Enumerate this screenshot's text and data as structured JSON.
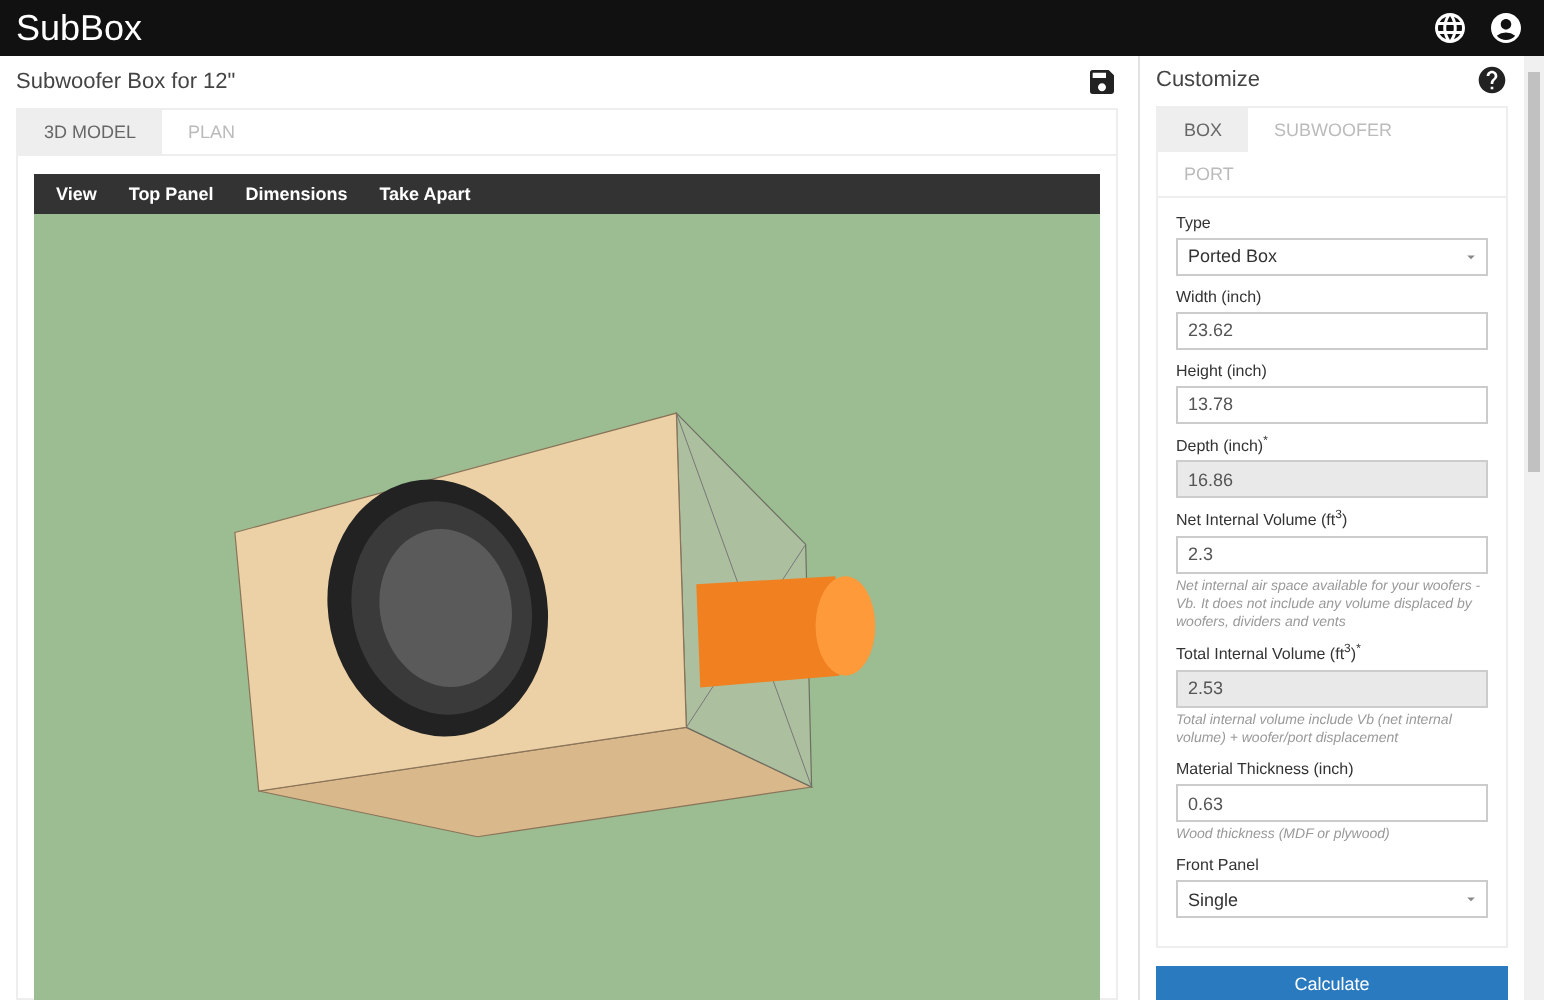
{
  "app": {
    "title": "SubBox"
  },
  "project": {
    "title": "Subwoofer Box for 12\""
  },
  "view_tabs": [
    {
      "label": "3D MODEL",
      "selected": true
    },
    {
      "label": "PLAN",
      "selected": false
    }
  ],
  "viewer_menu": [
    "View",
    "Top Panel",
    "Dimensions",
    "Take Apart"
  ],
  "customize": {
    "title": "Customize",
    "tabs": [
      {
        "label": "BOX",
        "selected": true
      },
      {
        "label": "SUBWOOFER",
        "selected": false
      },
      {
        "label": "PORT",
        "selected": false
      }
    ],
    "fields": [
      {
        "kind": "select",
        "label": "Type",
        "value": "Ported Box",
        "disabled": false
      },
      {
        "kind": "input",
        "label": "Width (inch)",
        "value": "23.62",
        "disabled": false
      },
      {
        "kind": "input",
        "label": "Height (inch)",
        "value": "13.78",
        "disabled": false
      },
      {
        "kind": "input",
        "label": "Depth (inch)$^{*}$",
        "value": "16.86",
        "disabled": true
      },
      {
        "kind": "input",
        "label": "Net Internal Volume (ft$^{3}$)",
        "value": "2.3",
        "disabled": false,
        "help": "Net internal air space available for your woofers - Vb. It does not include any volume displaced by woofers, dividers and vents"
      },
      {
        "kind": "input",
        "label": "Total Internal Volume (ft$^{3}$)$^{*}$",
        "value": "2.53",
        "disabled": true,
        "help": "Total internal volume include Vb (net internal volume) + woofer/port displacement"
      },
      {
        "kind": "input",
        "label": "Material Thickness (inch)",
        "value": "0.63",
        "disabled": false,
        "help": "Wood thickness (MDF or plywood)"
      },
      {
        "kind": "select",
        "label": "Front Panel",
        "value": "Single",
        "disabled": false
      }
    ],
    "button": "Calculate"
  }
}
